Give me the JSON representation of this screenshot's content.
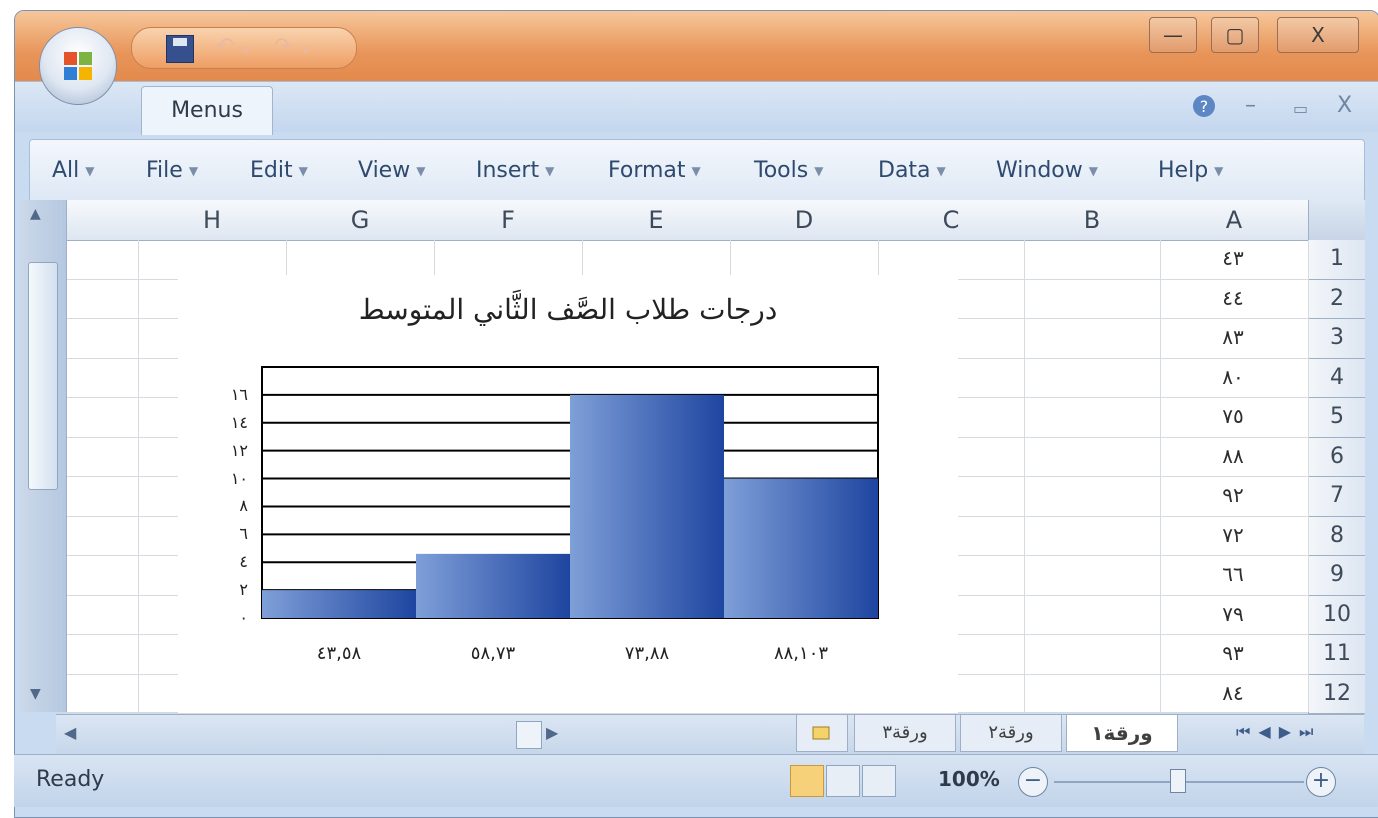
{
  "window": {
    "controls": {
      "minimize": "—",
      "restore": "▢",
      "close": "X"
    }
  },
  "ribbon": {
    "tabs": [
      {
        "label": "Menus"
      }
    ],
    "help_icon": "help-icon"
  },
  "menubar": {
    "items": [
      {
        "label": "All"
      },
      {
        "label": "File"
      },
      {
        "label": "Edit"
      },
      {
        "label": "View"
      },
      {
        "label": "Insert"
      },
      {
        "label": "Format"
      },
      {
        "label": "Tools"
      },
      {
        "label": "Data"
      },
      {
        "label": "Window"
      },
      {
        "label": "Help"
      }
    ]
  },
  "sheet": {
    "columns": [
      "H",
      "G",
      "F",
      "E",
      "D",
      "C",
      "B",
      "A"
    ],
    "rows": [
      "1",
      "2",
      "3",
      "4",
      "5",
      "6",
      "7",
      "8",
      "9",
      "10",
      "11",
      "12"
    ],
    "column_a_values": [
      "٤٣",
      "٤٤",
      "٨٣",
      "٨٠",
      "٧٥",
      "٨٨",
      "٩٢",
      "٧٢",
      "٦٦",
      "٧٩",
      "٩٣",
      "٨٤"
    ]
  },
  "chart_data": {
    "type": "bar",
    "title": "درجات طلاب الصَّف الثَّاني المتوسط",
    "categories": [
      "٨٨,١٠٣",
      "٧٣,٨٨",
      "٥٨,٧٣",
      "٤٣,٥٨"
    ],
    "values": [
      10,
      16,
      4.6,
      2
    ],
    "y_tick_labels": [
      "٠",
      "٢",
      "٤",
      "٦",
      "٨",
      "١٠",
      "١٢",
      "١٤",
      "١٦"
    ],
    "ylim": [
      0,
      18
    ],
    "grid": true,
    "legend": "none"
  },
  "sheet_tabs": [
    {
      "label": "ورقة١"
    },
    {
      "label": "ورقة٢"
    },
    {
      "label": "ورقة٣"
    }
  ],
  "status": {
    "text": "Ready",
    "zoom": "100%"
  }
}
